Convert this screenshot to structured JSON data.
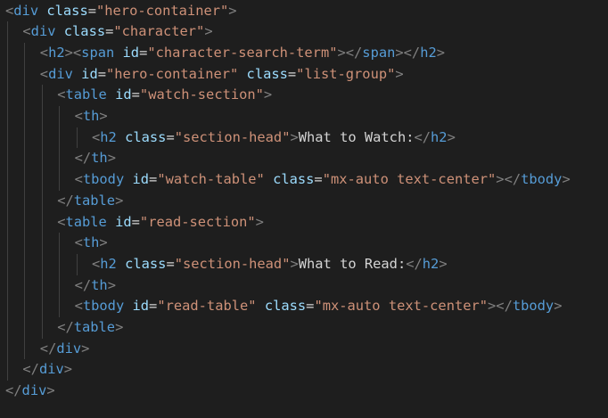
{
  "code": {
    "lines": [
      {
        "indent": 0,
        "tokens": [
          [
            "p",
            "<"
          ],
          [
            "t",
            "div"
          ],
          [
            "x",
            " "
          ],
          [
            "a",
            "class"
          ],
          [
            "e",
            "="
          ],
          [
            "s",
            "\"hero-container\""
          ],
          [
            "p",
            ">"
          ]
        ]
      },
      {
        "indent": 1,
        "tokens": [
          [
            "p",
            "<"
          ],
          [
            "t",
            "div"
          ],
          [
            "x",
            " "
          ],
          [
            "a",
            "class"
          ],
          [
            "e",
            "="
          ],
          [
            "s",
            "\"character\""
          ],
          [
            "p",
            ">"
          ]
        ]
      },
      {
        "indent": 2,
        "tokens": [
          [
            "p",
            "<"
          ],
          [
            "t",
            "h2"
          ],
          [
            "p",
            "><"
          ],
          [
            "t",
            "span"
          ],
          [
            "x",
            " "
          ],
          [
            "a",
            "id"
          ],
          [
            "e",
            "="
          ],
          [
            "s",
            "\"character-search-term\""
          ],
          [
            "p",
            "></"
          ],
          [
            "t",
            "span"
          ],
          [
            "p",
            "></"
          ],
          [
            "t",
            "h2"
          ],
          [
            "p",
            ">"
          ]
        ]
      },
      {
        "indent": 2,
        "tokens": [
          [
            "p",
            "<"
          ],
          [
            "t",
            "div"
          ],
          [
            "x",
            " "
          ],
          [
            "a",
            "id"
          ],
          [
            "e",
            "="
          ],
          [
            "s",
            "\"hero-container\""
          ],
          [
            "x",
            " "
          ],
          [
            "a",
            "class"
          ],
          [
            "e",
            "="
          ],
          [
            "s",
            "\"list-group\""
          ],
          [
            "p",
            ">"
          ]
        ]
      },
      {
        "indent": 3,
        "tokens": [
          [
            "p",
            "<"
          ],
          [
            "t",
            "table"
          ],
          [
            "x",
            " "
          ],
          [
            "a",
            "id"
          ],
          [
            "e",
            "="
          ],
          [
            "s",
            "\"watch-section\""
          ],
          [
            "p",
            ">"
          ]
        ]
      },
      {
        "indent": 4,
        "tokens": [
          [
            "p",
            "<"
          ],
          [
            "t",
            "th"
          ],
          [
            "p",
            ">"
          ]
        ]
      },
      {
        "indent": 5,
        "tokens": [
          [
            "p",
            "<"
          ],
          [
            "t",
            "h2"
          ],
          [
            "x",
            " "
          ],
          [
            "a",
            "class"
          ],
          [
            "e",
            "="
          ],
          [
            "s",
            "\"section-head\""
          ],
          [
            "p",
            ">"
          ],
          [
            "x",
            "What to Watch:"
          ],
          [
            "p",
            "</"
          ],
          [
            "t",
            "h2"
          ],
          [
            "p",
            ">"
          ]
        ]
      },
      {
        "indent": 4,
        "tokens": [
          [
            "p",
            "</"
          ],
          [
            "t",
            "th"
          ],
          [
            "p",
            ">"
          ]
        ]
      },
      {
        "indent": 4,
        "tokens": [
          [
            "p",
            "<"
          ],
          [
            "t",
            "tbody"
          ],
          [
            "x",
            " "
          ],
          [
            "a",
            "id"
          ],
          [
            "e",
            "="
          ],
          [
            "s",
            "\"watch-table\""
          ],
          [
            "x",
            " "
          ],
          [
            "a",
            "class"
          ],
          [
            "e",
            "="
          ],
          [
            "s",
            "\"mx-auto text-center\""
          ],
          [
            "p",
            "></"
          ],
          [
            "t",
            "tbody"
          ],
          [
            "p",
            ">"
          ]
        ]
      },
      {
        "indent": 3,
        "tokens": [
          [
            "p",
            "</"
          ],
          [
            "t",
            "table"
          ],
          [
            "p",
            ">"
          ]
        ]
      },
      {
        "indent": 3,
        "tokens": [
          [
            "p",
            "<"
          ],
          [
            "t",
            "table"
          ],
          [
            "x",
            " "
          ],
          [
            "a",
            "id"
          ],
          [
            "e",
            "="
          ],
          [
            "s",
            "\"read-section\""
          ],
          [
            "p",
            ">"
          ]
        ]
      },
      {
        "indent": 4,
        "tokens": [
          [
            "p",
            "<"
          ],
          [
            "t",
            "th"
          ],
          [
            "p",
            ">"
          ]
        ]
      },
      {
        "indent": 5,
        "tokens": [
          [
            "p",
            "<"
          ],
          [
            "t",
            "h2"
          ],
          [
            "x",
            " "
          ],
          [
            "a",
            "class"
          ],
          [
            "e",
            "="
          ],
          [
            "s",
            "\"section-head\""
          ],
          [
            "p",
            ">"
          ],
          [
            "x",
            "What to Read:"
          ],
          [
            "p",
            "</"
          ],
          [
            "t",
            "h2"
          ],
          [
            "p",
            ">"
          ]
        ]
      },
      {
        "indent": 4,
        "tokens": [
          [
            "p",
            "</"
          ],
          [
            "t",
            "th"
          ],
          [
            "p",
            ">"
          ]
        ]
      },
      {
        "indent": 4,
        "tokens": [
          [
            "p",
            "<"
          ],
          [
            "t",
            "tbody"
          ],
          [
            "x",
            " "
          ],
          [
            "a",
            "id"
          ],
          [
            "e",
            "="
          ],
          [
            "s",
            "\"read-table\""
          ],
          [
            "x",
            " "
          ],
          [
            "a",
            "class"
          ],
          [
            "e",
            "="
          ],
          [
            "s",
            "\"mx-auto text-center\""
          ],
          [
            "p",
            "></"
          ],
          [
            "t",
            "tbody"
          ],
          [
            "p",
            ">"
          ]
        ]
      },
      {
        "indent": 3,
        "tokens": [
          [
            "p",
            "</"
          ],
          [
            "t",
            "table"
          ],
          [
            "p",
            ">"
          ]
        ]
      },
      {
        "indent": 2,
        "tokens": [
          [
            "p",
            "</"
          ],
          [
            "t",
            "div"
          ],
          [
            "p",
            ">"
          ]
        ]
      },
      {
        "indent": 1,
        "tokens": [
          [
            "p",
            "</"
          ],
          [
            "t",
            "div"
          ],
          [
            "p",
            ">"
          ]
        ]
      },
      {
        "indent": 0,
        "tokens": [
          [
            "p",
            "</"
          ],
          [
            "t",
            "div"
          ],
          [
            "p",
            ">"
          ]
        ]
      }
    ]
  },
  "colors": {
    "background": "#1e1e1e",
    "punctuation": "#808080",
    "tag": "#569cd6",
    "attribute": "#9cdcfe",
    "string": "#ce9178",
    "text": "#d4d4d4",
    "indent_guide": "#404040"
  }
}
